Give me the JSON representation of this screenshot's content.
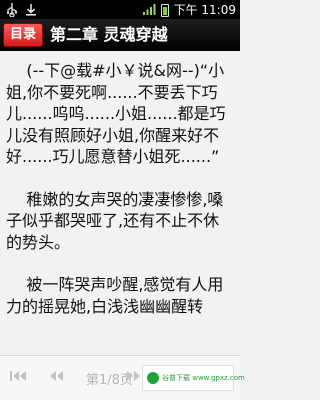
{
  "status_bar": {
    "time": "下午 11:09"
  },
  "header": {
    "back_label": "目录",
    "chapter_title": "第二章 灵魂穿越"
  },
  "content": {
    "paragraphs": [
      "    (--下@载#小￥说&网--)“小姐,你不要死啊......不要丢下巧儿......呜呜......小姐......都是巧儿没有照顾好小姐,你醒来好不好......巧儿愿意替小姐死......”",
      "    稚嫩的女声哭的凄凄惨惨,嗓子似乎都哭哑了,还有不止不休的势头。",
      "    被一阵哭声吵醒,感觉有人用力的摇晃她,白浅浅幽幽醒转"
    ]
  },
  "footer": {
    "page_label": "第1/8页",
    "ad_text": "谷普下载 www.gpxz.com"
  },
  "icons": {
    "usb": "usb-icon",
    "download": "download-icon",
    "signal": "signal-icon",
    "battery": "battery-icon",
    "first_page": "first-page-icon",
    "prev_page": "prev-page-icon",
    "next_page": "next-page-icon",
    "last_page": "last-page-icon"
  },
  "colors": {
    "status_bar_bg": "#000000",
    "title_bar_bg": "#000000",
    "back_button": "#d61a1a",
    "content_bg": "#f2f2f2",
    "text": "#111111",
    "battery_fill": "#7ccf3f",
    "ad_green": "#1ea33b"
  }
}
